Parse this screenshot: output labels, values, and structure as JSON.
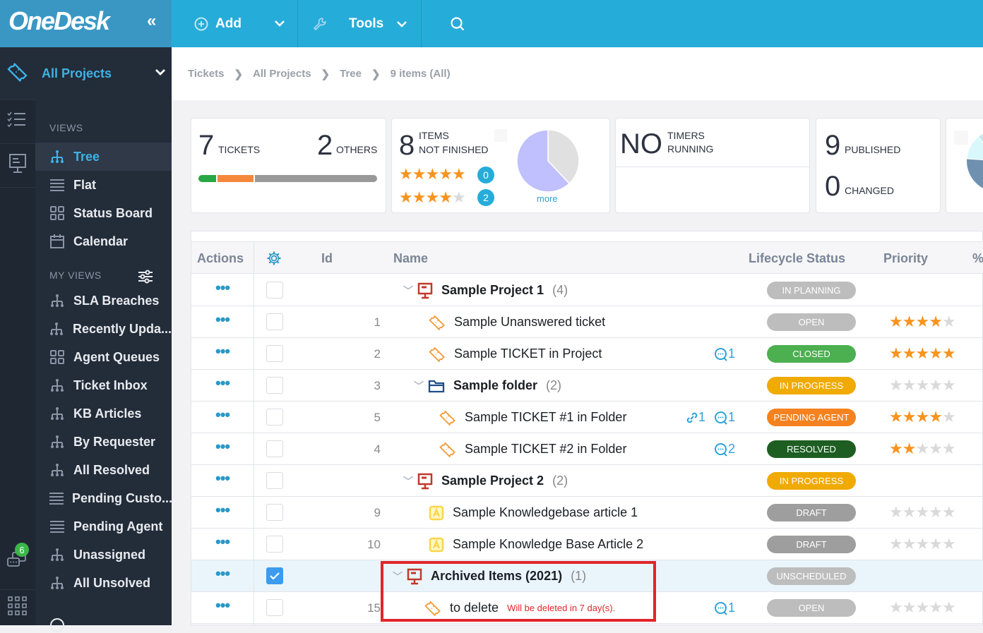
{
  "app": {
    "logo": "OneDesk",
    "collapse": "«"
  },
  "topbar": {
    "add_label": "Add",
    "tools_label": "Tools"
  },
  "sidebar": {
    "project_selector": "All Projects",
    "views_title": "VIEWS",
    "views": [
      {
        "label": "Tree",
        "icon": "tree-icon",
        "active": true
      },
      {
        "label": "Flat",
        "icon": "list-icon"
      },
      {
        "label": "Status Board",
        "icon": "board-icon"
      },
      {
        "label": "Calendar",
        "icon": "calendar-icon"
      }
    ],
    "my_views_title": "MY VIEWS",
    "my_views": [
      {
        "label": "SLA Breaches",
        "icon": "tree-icon"
      },
      {
        "label": "Recently Upda...",
        "icon": "tree-icon"
      },
      {
        "label": "Agent Queues",
        "icon": "board-icon"
      },
      {
        "label": "Ticket Inbox",
        "icon": "tree-icon"
      },
      {
        "label": "KB Articles",
        "icon": "tree-icon"
      },
      {
        "label": "By Requester",
        "icon": "tree-icon"
      },
      {
        "label": "All Resolved",
        "icon": "tree-icon"
      },
      {
        "label": "Pending Custo...",
        "icon": "list-icon"
      },
      {
        "label": "Pending Agent",
        "icon": "list-icon"
      },
      {
        "label": "Unassigned",
        "icon": "tree-icon"
      },
      {
        "label": "All Unsolved",
        "icon": "tree-icon"
      }
    ]
  },
  "rail": {
    "messages_badge": "6"
  },
  "breadcrumb": [
    "Tickets",
    "All Projects",
    "Tree",
    "9 items (All)"
  ],
  "cards": {
    "tickets": {
      "count": "7",
      "label": "TICKETS",
      "others_count": "2",
      "others_label": "OTHERS",
      "bar": [
        {
          "fraction": 0.1,
          "color": "#28a745"
        },
        {
          "fraction": 0.21,
          "color": "#f5873c"
        },
        {
          "fraction": 0.69,
          "color": "#999999"
        }
      ]
    },
    "not_finished": {
      "count": "8",
      "label1": "ITEMS",
      "label2": "NOT FINISHED",
      "five_star_count": "0",
      "four_star_count": "2",
      "more": "more",
      "pie": [
        {
          "fraction": 0.62,
          "color": "#c0c0ff"
        },
        {
          "fraction": 0.38,
          "color": "#e0e0e0"
        }
      ]
    },
    "timers": {
      "count": "NO",
      "label1": "TIMERS",
      "label2": "RUNNING"
    },
    "published": {
      "count": "9",
      "label": "PUBLISHED",
      "changed_count": "0",
      "changed_label": "CHANGED"
    }
  },
  "grid": {
    "headers": {
      "actions": "Actions",
      "id": "Id",
      "name": "Name",
      "status": "Lifecycle Status",
      "priority": "Priority",
      "percent": "%"
    },
    "rows": [
      {
        "id": "",
        "name": "Sample Project 1",
        "count": "(4)",
        "type": "project",
        "level": 0,
        "status": "IN PLANNING",
        "status_color": "#bdbdbd",
        "priority": null,
        "links": "",
        "comments": ""
      },
      {
        "id": "1",
        "name": "Sample Unanswered ticket",
        "type": "ticket",
        "level": 1,
        "status": "OPEN",
        "status_color": "#bdbdbd",
        "priority": 4,
        "links": "",
        "comments": ""
      },
      {
        "id": "2",
        "name": "Sample TICKET in Project",
        "type": "ticket",
        "level": 1,
        "status": "CLOSED",
        "status_color": "#4caf50",
        "priority": 5,
        "links": "",
        "comments": "1"
      },
      {
        "id": "3",
        "name": "Sample folder",
        "count": "(2)",
        "type": "folder",
        "level": 1,
        "status": "IN PROGRESS",
        "status_color": "#f0aa00",
        "priority": 0,
        "links": "",
        "comments": ""
      },
      {
        "id": "5",
        "name": "Sample TICKET #1 in Folder",
        "type": "ticket",
        "level": 2,
        "status": "PENDING AGENT",
        "status_color": "#f5821f",
        "priority": 4,
        "links": "1",
        "comments": "1"
      },
      {
        "id": "4",
        "name": "Sample TICKET #2 in Folder",
        "type": "ticket",
        "level": 2,
        "status": "RESOLVED",
        "status_color": "#1e5e23",
        "priority": 2,
        "links": "",
        "comments": "2"
      },
      {
        "id": "",
        "name": "Sample Project 2",
        "count": "(2)",
        "type": "project",
        "level": 0,
        "status": "IN PROGRESS",
        "status_color": "#f0aa00",
        "priority": null,
        "links": "",
        "comments": ""
      },
      {
        "id": "9",
        "name": "Sample Knowledgebase article 1",
        "type": "article",
        "level": 1,
        "status": "DRAFT",
        "status_color": "#9e9e9e",
        "priority": 0,
        "links": "",
        "comments": ""
      },
      {
        "id": "10",
        "name": "Sample Knowledge Base Article 2",
        "type": "article",
        "level": 1,
        "status": "DRAFT",
        "status_color": "#9e9e9e",
        "priority": 0,
        "links": "",
        "comments": ""
      },
      {
        "id": "",
        "name": "Archived Items (2021)",
        "count": "(1)",
        "type": "project",
        "level": -1,
        "status": "UNSCHEDULED",
        "status_color": "#bdbdbd",
        "priority": null,
        "links": "",
        "comments": "",
        "selected": true
      },
      {
        "id": "15",
        "name": "to delete",
        "type": "ticket",
        "level": 0,
        "status": "OPEN",
        "status_color": "#bdbdbd",
        "priority": 0,
        "links": "",
        "comments": "1",
        "warning": "Will be deleted in 7 day(s)."
      }
    ]
  }
}
